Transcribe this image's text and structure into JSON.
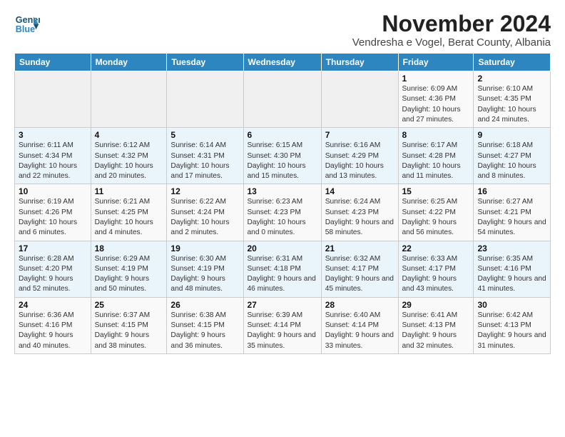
{
  "logo": {
    "line1": "General",
    "line2": "Blue"
  },
  "title": "November 2024",
  "subtitle": "Vendresha e Vogel, Berat County, Albania",
  "days_of_week": [
    "Sunday",
    "Monday",
    "Tuesday",
    "Wednesday",
    "Thursday",
    "Friday",
    "Saturday"
  ],
  "weeks": [
    [
      {
        "day": "",
        "info": ""
      },
      {
        "day": "",
        "info": ""
      },
      {
        "day": "",
        "info": ""
      },
      {
        "day": "",
        "info": ""
      },
      {
        "day": "",
        "info": ""
      },
      {
        "day": "1",
        "info": "Sunrise: 6:09 AM\nSunset: 4:36 PM\nDaylight: 10 hours and 27 minutes."
      },
      {
        "day": "2",
        "info": "Sunrise: 6:10 AM\nSunset: 4:35 PM\nDaylight: 10 hours and 24 minutes."
      }
    ],
    [
      {
        "day": "3",
        "info": "Sunrise: 6:11 AM\nSunset: 4:34 PM\nDaylight: 10 hours and 22 minutes."
      },
      {
        "day": "4",
        "info": "Sunrise: 6:12 AM\nSunset: 4:32 PM\nDaylight: 10 hours and 20 minutes."
      },
      {
        "day": "5",
        "info": "Sunrise: 6:14 AM\nSunset: 4:31 PM\nDaylight: 10 hours and 17 minutes."
      },
      {
        "day": "6",
        "info": "Sunrise: 6:15 AM\nSunset: 4:30 PM\nDaylight: 10 hours and 15 minutes."
      },
      {
        "day": "7",
        "info": "Sunrise: 6:16 AM\nSunset: 4:29 PM\nDaylight: 10 hours and 13 minutes."
      },
      {
        "day": "8",
        "info": "Sunrise: 6:17 AM\nSunset: 4:28 PM\nDaylight: 10 hours and 11 minutes."
      },
      {
        "day": "9",
        "info": "Sunrise: 6:18 AM\nSunset: 4:27 PM\nDaylight: 10 hours and 8 minutes."
      }
    ],
    [
      {
        "day": "10",
        "info": "Sunrise: 6:19 AM\nSunset: 4:26 PM\nDaylight: 10 hours and 6 minutes."
      },
      {
        "day": "11",
        "info": "Sunrise: 6:21 AM\nSunset: 4:25 PM\nDaylight: 10 hours and 4 minutes."
      },
      {
        "day": "12",
        "info": "Sunrise: 6:22 AM\nSunset: 4:24 PM\nDaylight: 10 hours and 2 minutes."
      },
      {
        "day": "13",
        "info": "Sunrise: 6:23 AM\nSunset: 4:23 PM\nDaylight: 10 hours and 0 minutes."
      },
      {
        "day": "14",
        "info": "Sunrise: 6:24 AM\nSunset: 4:23 PM\nDaylight: 9 hours and 58 minutes."
      },
      {
        "day": "15",
        "info": "Sunrise: 6:25 AM\nSunset: 4:22 PM\nDaylight: 9 hours and 56 minutes."
      },
      {
        "day": "16",
        "info": "Sunrise: 6:27 AM\nSunset: 4:21 PM\nDaylight: 9 hours and 54 minutes."
      }
    ],
    [
      {
        "day": "17",
        "info": "Sunrise: 6:28 AM\nSunset: 4:20 PM\nDaylight: 9 hours and 52 minutes."
      },
      {
        "day": "18",
        "info": "Sunrise: 6:29 AM\nSunset: 4:19 PM\nDaylight: 9 hours and 50 minutes."
      },
      {
        "day": "19",
        "info": "Sunrise: 6:30 AM\nSunset: 4:19 PM\nDaylight: 9 hours and 48 minutes."
      },
      {
        "day": "20",
        "info": "Sunrise: 6:31 AM\nSunset: 4:18 PM\nDaylight: 9 hours and 46 minutes."
      },
      {
        "day": "21",
        "info": "Sunrise: 6:32 AM\nSunset: 4:17 PM\nDaylight: 9 hours and 45 minutes."
      },
      {
        "day": "22",
        "info": "Sunrise: 6:33 AM\nSunset: 4:17 PM\nDaylight: 9 hours and 43 minutes."
      },
      {
        "day": "23",
        "info": "Sunrise: 6:35 AM\nSunset: 4:16 PM\nDaylight: 9 hours and 41 minutes."
      }
    ],
    [
      {
        "day": "24",
        "info": "Sunrise: 6:36 AM\nSunset: 4:16 PM\nDaylight: 9 hours and 40 minutes."
      },
      {
        "day": "25",
        "info": "Sunrise: 6:37 AM\nSunset: 4:15 PM\nDaylight: 9 hours and 38 minutes."
      },
      {
        "day": "26",
        "info": "Sunrise: 6:38 AM\nSunset: 4:15 PM\nDaylight: 9 hours and 36 minutes."
      },
      {
        "day": "27",
        "info": "Sunrise: 6:39 AM\nSunset: 4:14 PM\nDaylight: 9 hours and 35 minutes."
      },
      {
        "day": "28",
        "info": "Sunrise: 6:40 AM\nSunset: 4:14 PM\nDaylight: 9 hours and 33 minutes."
      },
      {
        "day": "29",
        "info": "Sunrise: 6:41 AM\nSunset: 4:13 PM\nDaylight: 9 hours and 32 minutes."
      },
      {
        "day": "30",
        "info": "Sunrise: 6:42 AM\nSunset: 4:13 PM\nDaylight: 9 hours and 31 minutes."
      }
    ]
  ]
}
